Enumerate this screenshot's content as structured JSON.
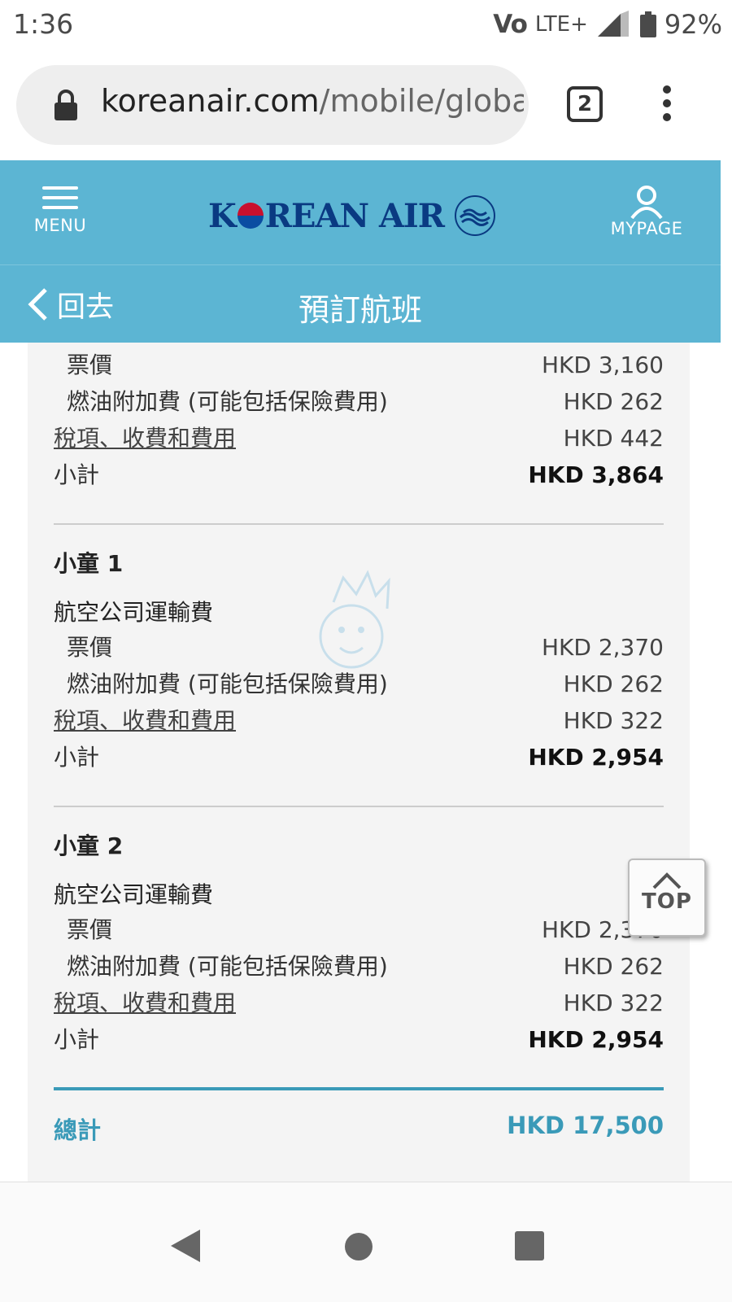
{
  "status_bar": {
    "time": "1:36",
    "carrier": "Vo",
    "network": "LTE+",
    "battery": "92%"
  },
  "browser": {
    "url_domain": "koreanair.com",
    "url_path": "/mobile/global",
    "tab_count": "2"
  },
  "header": {
    "menu_label": "MENU",
    "logo_text_1": "K",
    "logo_text_2": "REAN AIR",
    "mypage_label": "MYPAGE",
    "back_label": "回去",
    "page_title": "預訂航班"
  },
  "top_partial": {
    "rows": [
      {
        "label": "票價",
        "value": "HKD 3,160"
      },
      {
        "label": "燃油附加費 (可能包括保險費用)",
        "value": "HKD 262"
      },
      {
        "label": "稅項、收費和費用",
        "value": "HKD 442"
      },
      {
        "label": "小計",
        "value": "HKD 3,864"
      }
    ]
  },
  "passengers": [
    {
      "title": "小童 1",
      "section": "航空公司運輸費",
      "rows": [
        {
          "label": "票價",
          "value": "HKD 2,370"
        },
        {
          "label": "燃油附加費 (可能包括保險費用)",
          "value": "HKD 262"
        },
        {
          "label": "稅項、收費和費用",
          "value": "HKD 322"
        },
        {
          "label": "小計",
          "value": "HKD 2,954"
        }
      ]
    },
    {
      "title": "小童 2",
      "section": "航空公司運輸費",
      "rows": [
        {
          "label": "票價",
          "value": "HKD 2,370"
        },
        {
          "label": "燃油附加費 (可能包括保險費用)",
          "value": "HKD 262"
        },
        {
          "label": "稅項、收費和費用",
          "value": "HKD 322"
        },
        {
          "label": "小計",
          "value": "HKD 2,954"
        }
      ]
    }
  ],
  "total": {
    "label": "總計",
    "value": "HKD 17,500"
  },
  "top_button": "TOP",
  "colors": {
    "header_bg": "#5cb5d3",
    "accent": "#3a9ab8",
    "logo_blue": "#0a3a82",
    "logo_red": "#c8102e"
  }
}
